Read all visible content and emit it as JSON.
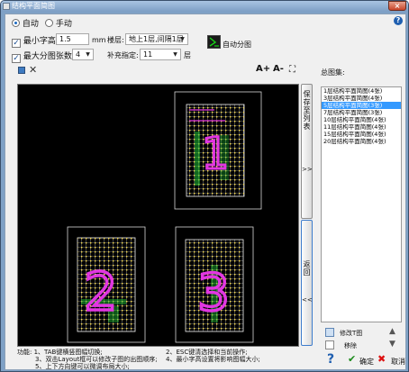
{
  "window": {
    "title": "结构平面简图",
    "close_icon": "×"
  },
  "mode": {
    "auto_label": "自动",
    "manual_label": "手动",
    "selected": "auto"
  },
  "help_icon": "?",
  "options": {
    "min_font_label": "最小字高:",
    "min_font_value": "1.5",
    "min_font_unit": "mm",
    "max_group_label": "最大分图张数:",
    "max_group_value": "4",
    "floor_label": "楼层:",
    "floor_value": "地上1层,间隔1层",
    "renumber_label": "补充指定:",
    "renumber_value": "11",
    "renumber_unit": "层",
    "auto_split_label": "自动分图"
  },
  "preview_toolbar": {
    "zoom_in": "A+",
    "zoom_out": "A-"
  },
  "side_buttons": {
    "save_to_list": "保存至列表",
    "save_arrows": ">>",
    "back": "返回",
    "back_arrows": "<<"
  },
  "total_list": {
    "label": "总图集:",
    "items": [
      "1层结构平面简图(4张)",
      "3层结构平面简图(4张)",
      "5层结构平面简图(3张)",
      "7层结构平面简图(3张)",
      "10层结构平面简图(4张)",
      "11层结构平面简图(4张)",
      "15层结构平面简图(4张)",
      "20层结构平面简图(4张)"
    ],
    "selected_index": 2
  },
  "list_actions": {
    "edit_label": "修改T图",
    "move_label": "移除"
  },
  "footer": {
    "help_lines": [
      "功能: 1、TAB键横竖图幅切换;",
      "2、ESC键清选择和当前操作;",
      "3、双击Layout框可以修改子图的出图顺序;",
      "4、最小字高设置将影响图幅大小;",
      "5、上下方向键可以微调布局大小;"
    ],
    "ok_label": "确定",
    "cancel_label": "取消"
  },
  "plan_labels": [
    "1",
    "2",
    "3"
  ]
}
